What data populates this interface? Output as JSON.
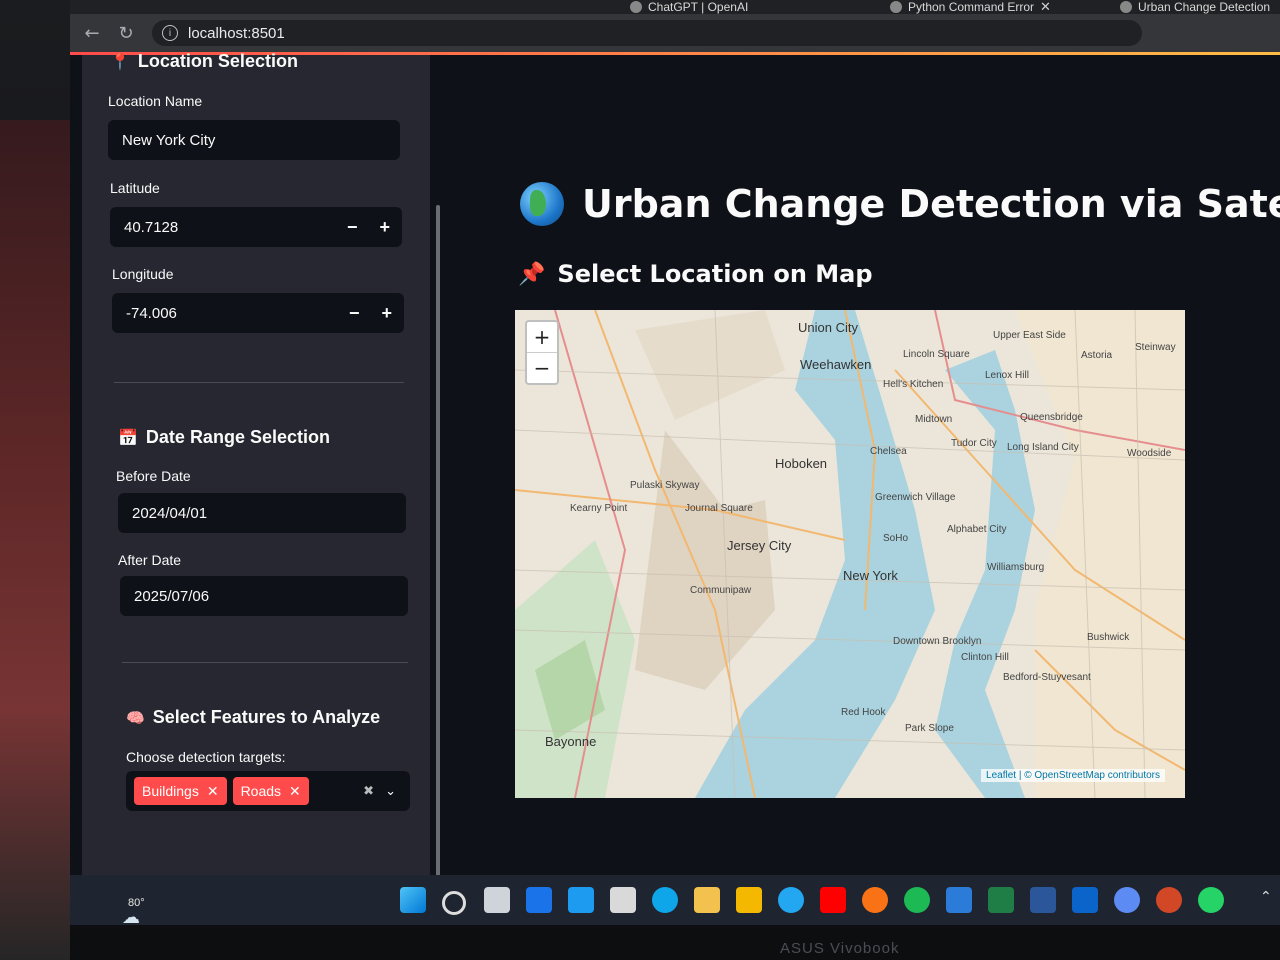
{
  "browser": {
    "tabs": [
      {
        "label": "ChatGPT | OpenAI"
      },
      {
        "label": "Python Command Error"
      },
      {
        "label": "Urban Change Detection"
      }
    ],
    "url": "localhost:8501"
  },
  "sidebar": {
    "location_header": "Location Selection",
    "location_name_label": "Location Name",
    "location_name_value": "New York City",
    "latitude_label": "Latitude",
    "latitude_value": "40.7128",
    "longitude_label": "Longitude",
    "longitude_value": "-74.006",
    "date_header": "Date Range Selection",
    "before_date_label": "Before Date",
    "before_date_value": "2024/04/01",
    "after_date_label": "After Date",
    "after_date_value": "2025/07/06",
    "features_header": "Select Features to Analyze",
    "features_label": "Choose detection targets:",
    "chips": [
      "Buildings",
      "Roads"
    ],
    "minus": "−",
    "plus": "+"
  },
  "main": {
    "title": "Urban Change Detection via Satellite",
    "subtitle": "Select Location on Map"
  },
  "map": {
    "zoom_in": "+",
    "zoom_out": "−",
    "attribution": "Leaflet | © OpenStreetMap contributors",
    "labels": [
      "Union City",
      "Weehawken",
      "Hoboken",
      "Jersey City",
      "New York",
      "Midtown",
      "Chelsea",
      "Greenwich Village",
      "SoHo",
      "Hell's Kitchen",
      "Lincoln Square",
      "Upper East Side",
      "Astoria",
      "Lenox Hill",
      "Queensbridge",
      "Tudor City",
      "Long Island City",
      "Williamsburg",
      "Downtown Brooklyn",
      "Clinton Hill",
      "Bushwick",
      "Bedford-Stuyvesant",
      "Red Hook",
      "Park Slope",
      "Bayonne",
      "Communipaw",
      "Journal Square",
      "Pulaski Skyway",
      "Kearny Point",
      "Alphabet City",
      "Woodside",
      "Steinway"
    ]
  },
  "taskbar": {
    "weather": "80°"
  },
  "device": {
    "brand": "ASUS Vivobook"
  },
  "colors": {
    "accent": "#ff4b4b",
    "sidebar_bg": "#262730",
    "app_bg": "#0e1117"
  }
}
